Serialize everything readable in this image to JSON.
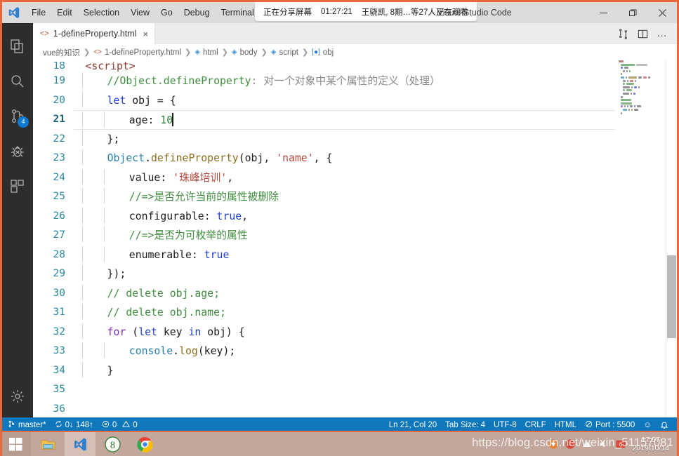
{
  "window": {
    "app_title": "- Visual Studio Code",
    "logo_name": "vscode-logo"
  },
  "menubar": {
    "items": [
      {
        "label": "File"
      },
      {
        "label": "Edit"
      },
      {
        "label": "Selection"
      },
      {
        "label": "View"
      },
      {
        "label": "Go"
      },
      {
        "label": "Debug"
      },
      {
        "label": "Terminal"
      },
      {
        "label": "Help"
      }
    ]
  },
  "share_bar": {
    "status": "正在分享屏幕",
    "timer": "01:27:21",
    "viewers": "王骁凯, 8期…等27人正在观看"
  },
  "window_controls": {
    "minimize": "minimize",
    "maximize": "restore",
    "close": "close"
  },
  "activitybar": {
    "items": [
      {
        "name": "explorer",
        "label": "Explorer"
      },
      {
        "name": "search",
        "label": "Search"
      },
      {
        "name": "source-control",
        "label": "Source Control",
        "badge": "4"
      },
      {
        "name": "run-debug",
        "label": "Run and Debug"
      },
      {
        "name": "extensions",
        "label": "Extensions"
      }
    ],
    "bottom": [
      {
        "name": "manage",
        "label": "Manage"
      }
    ]
  },
  "tabs": [
    {
      "label": "1-defineProperty.html",
      "icon": "html-file-icon",
      "close": "×",
      "active": true
    }
  ],
  "editor_actions": [
    {
      "name": "run-split",
      "label": "Split"
    },
    {
      "name": "split-editor",
      "label": "Split Editor"
    },
    {
      "name": "more-actions",
      "label": "…"
    }
  ],
  "breadcrumbs": [
    {
      "label": "vue的知识",
      "icon": "folder"
    },
    {
      "label": "1-defineProperty.html",
      "icon": "html"
    },
    {
      "label": "html",
      "icon": "tag"
    },
    {
      "label": "body",
      "icon": "tag"
    },
    {
      "label": "script",
      "icon": "tag"
    },
    {
      "label": "obj",
      "icon": "obj"
    }
  ],
  "editor": {
    "first_line": 18,
    "active_line": 21,
    "lines": [
      {
        "n": 18,
        "tokens": [
          {
            "t": "<script>",
            "c": "tok-tag"
          }
        ],
        "indent": 1,
        "clipped": true
      },
      {
        "n": 19,
        "tokens": [
          {
            "t": "//Object.defineProperty",
            "c": "tok-com"
          },
          {
            "t": ": 对一个对象中某个属性的定义（处理）",
            "c": "tok-com-cn"
          }
        ],
        "indent": 2
      },
      {
        "n": 20,
        "tokens": [
          {
            "t": "let",
            "c": "tok-kw"
          },
          {
            "t": " obj = {",
            "c": "tok-plain"
          }
        ],
        "indent": 2
      },
      {
        "n": 21,
        "tokens": [
          {
            "t": "age",
            "c": "tok-prop"
          },
          {
            "t": ": ",
            "c": "tok-plain"
          },
          {
            "t": "10",
            "c": "tok-num"
          }
        ],
        "indent": 3,
        "active": true
      },
      {
        "n": 22,
        "tokens": [
          {
            "t": "};",
            "c": "tok-plain"
          }
        ],
        "indent": 2
      },
      {
        "n": 23,
        "tokens": [
          {
            "t": "Object",
            "c": "tok-obj"
          },
          {
            "t": ".",
            "c": "tok-plain"
          },
          {
            "t": "defineProperty",
            "c": "tok-fn"
          },
          {
            "t": "(obj, ",
            "c": "tok-plain"
          },
          {
            "t": "'name'",
            "c": "tok-str"
          },
          {
            "t": ", {",
            "c": "tok-plain"
          }
        ],
        "indent": 2
      },
      {
        "n": 24,
        "tokens": [
          {
            "t": "value",
            "c": "tok-plain"
          },
          {
            "t": ": ",
            "c": "tok-plain"
          },
          {
            "t": "'珠峰培训'",
            "c": "tok-str"
          },
          {
            "t": ",",
            "c": "tok-plain"
          }
        ],
        "indent": 3
      },
      {
        "n": 25,
        "tokens": [
          {
            "t": "//=>",
            "c": "tok-com"
          },
          {
            "t": "是否允许当前的属性被删除",
            "c": "tok-com"
          }
        ],
        "indent": 3
      },
      {
        "n": 26,
        "tokens": [
          {
            "t": "configurable",
            "c": "tok-plain"
          },
          {
            "t": ": ",
            "c": "tok-plain"
          },
          {
            "t": "true",
            "c": "tok-kw"
          },
          {
            "t": ",",
            "c": "tok-plain"
          }
        ],
        "indent": 3
      },
      {
        "n": 27,
        "tokens": [
          {
            "t": "//=>",
            "c": "tok-com"
          },
          {
            "t": "是否为可枚举的属性",
            "c": "tok-com"
          }
        ],
        "indent": 3
      },
      {
        "n": 28,
        "tokens": [
          {
            "t": "enumerable",
            "c": "tok-plain"
          },
          {
            "t": ": ",
            "c": "tok-plain"
          },
          {
            "t": "true",
            "c": "tok-kw"
          }
        ],
        "indent": 3
      },
      {
        "n": 29,
        "tokens": [
          {
            "t": "});",
            "c": "tok-plain"
          }
        ],
        "indent": 2
      },
      {
        "n": 30,
        "tokens": [
          {
            "t": "// delete obj.age;",
            "c": "tok-com"
          }
        ],
        "indent": 2
      },
      {
        "n": 31,
        "tokens": [
          {
            "t": "// delete obj.name;",
            "c": "tok-com"
          }
        ],
        "indent": 2
      },
      {
        "n": 32,
        "tokens": [
          {
            "t": "for",
            "c": "tok-kw2"
          },
          {
            "t": " (",
            "c": "tok-plain"
          },
          {
            "t": "let",
            "c": "tok-kw"
          },
          {
            "t": " key ",
            "c": "tok-plain"
          },
          {
            "t": "in",
            "c": "tok-kw"
          },
          {
            "t": " obj) {",
            "c": "tok-plain"
          }
        ],
        "indent": 2
      },
      {
        "n": 33,
        "tokens": [
          {
            "t": "console",
            "c": "tok-obj"
          },
          {
            "t": ".",
            "c": "tok-plain"
          },
          {
            "t": "log",
            "c": "tok-fn"
          },
          {
            "t": "(key);",
            "c": "tok-plain"
          }
        ],
        "indent": 3
      },
      {
        "n": 34,
        "tokens": [
          {
            "t": "}",
            "c": "tok-plain"
          }
        ],
        "indent": 2
      },
      {
        "n": 35,
        "tokens": [],
        "indent": 0
      },
      {
        "n": 36,
        "tokens": [],
        "indent": 0
      }
    ]
  },
  "statusbar": {
    "left": [
      {
        "name": "branch",
        "icon": "source-control-icon",
        "label": "master*"
      },
      {
        "name": "sync",
        "icon": "sync-icon",
        "label": "0↓ 148↑"
      },
      {
        "name": "problems",
        "icon": "error-warning-icon",
        "label": "0",
        "label2": "0"
      }
    ],
    "right": [
      {
        "name": "cursor-position",
        "label": "Ln 21, Col 20"
      },
      {
        "name": "tab-size",
        "label": "Tab Size: 4"
      },
      {
        "name": "encoding",
        "label": "UTF-8"
      },
      {
        "name": "eol",
        "label": "CRLF"
      },
      {
        "name": "language-mode",
        "label": "HTML"
      },
      {
        "name": "live-server-port",
        "label": "Port : 5500",
        "icon": "broadcast-icon"
      },
      {
        "name": "feedback",
        "label": "☺"
      },
      {
        "name": "notifications",
        "label": "bell-icon"
      }
    ]
  },
  "taskbar": {
    "start": "start-button",
    "apps": [
      {
        "name": "file-explorer",
        "label": "File Explorer"
      },
      {
        "name": "visual-studio-code",
        "label": "Visual Studio Code",
        "active": true
      },
      {
        "name": "eight-app",
        "label": "8"
      },
      {
        "name": "google-chrome",
        "label": "Google Chrome"
      }
    ],
    "clock": {
      "time": "17:57",
      "date": "2019/10/14"
    },
    "watermark": "https://blog.csdn.net/weixin_51157081"
  },
  "colors": {
    "accent_orange": "#e8683c",
    "statusbar_blue": "#1177bb",
    "activitybar_dark": "#2d2d2d",
    "badge_blue": "#0e7ad1"
  }
}
